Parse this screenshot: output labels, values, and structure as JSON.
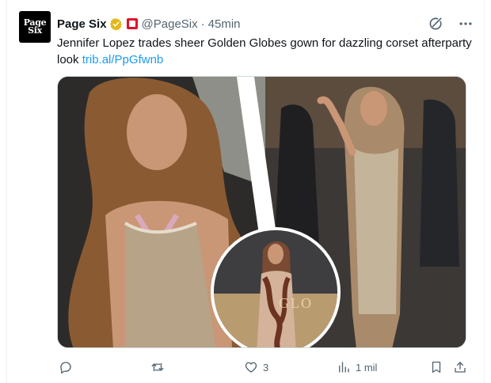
{
  "account": {
    "display_name": "Page Six",
    "handle": "@PageSix",
    "separator": "·",
    "time": "45min",
    "avatar_lines": [
      "Page",
      "Six"
    ],
    "verified_color": "#e2b719"
  },
  "tweet": {
    "text": "Jennifer Lopez trades sheer Golden Globes gown for dazzling corset afterparty look",
    "link": "trib.al/PpGfwnb"
  },
  "media": {
    "inset_text": "GLO"
  },
  "metrics": {
    "likes": "3",
    "views": "1 mil"
  },
  "icons": {
    "header": [
      "grok-icon",
      "more-icon"
    ],
    "actions": [
      "reply-icon",
      "retweet-icon",
      "like-icon",
      "views-icon",
      "bookmark-icon",
      "share-icon"
    ]
  },
  "colors": {
    "link": "#1d9bf0",
    "muted": "#536471",
    "brand_red": "#e0112b"
  }
}
